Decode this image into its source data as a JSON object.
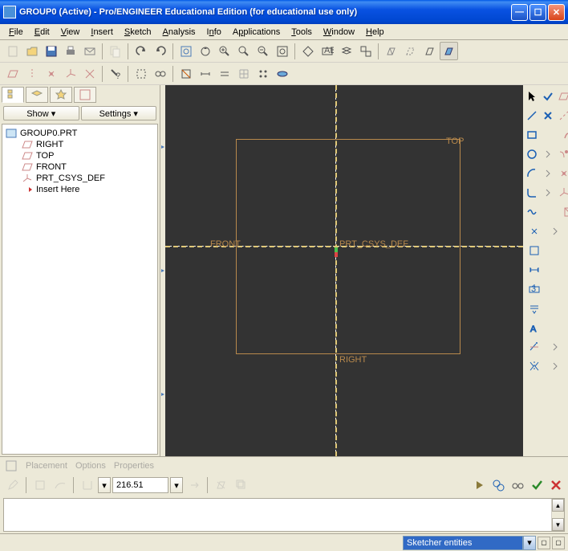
{
  "window": {
    "title": "GROUP0 (Active) - Pro/ENGINEER Educational Edition (for educational use only)"
  },
  "menu": {
    "file": "File",
    "edit": "Edit",
    "view": "View",
    "insert": "Insert",
    "sketch": "Sketch",
    "analysis": "Analysis",
    "info": "Info",
    "applications": "Applications",
    "tools": "Tools",
    "window": "Window",
    "help": "Help"
  },
  "panel": {
    "show_btn": "Show ▾",
    "settings_btn": "Settings ▾"
  },
  "tree": {
    "root": "GROUP0.PRT",
    "items": [
      {
        "label": "RIGHT"
      },
      {
        "label": "TOP"
      },
      {
        "label": "FRONT"
      },
      {
        "label": "PRT_CSYS_DEF"
      },
      {
        "label": "Insert Here"
      }
    ]
  },
  "viewport": {
    "top_label": "TOP",
    "front_label": "FRONT",
    "right_label": "RIGHT",
    "csys_label": "PRT_CSYS_DEF"
  },
  "dashboard": {
    "tab_placement": "Placement",
    "tab_options": "Options",
    "tab_properties": "Properties",
    "depth_value": "216.51"
  },
  "status": {
    "combo_value": "Sketcher entities"
  }
}
